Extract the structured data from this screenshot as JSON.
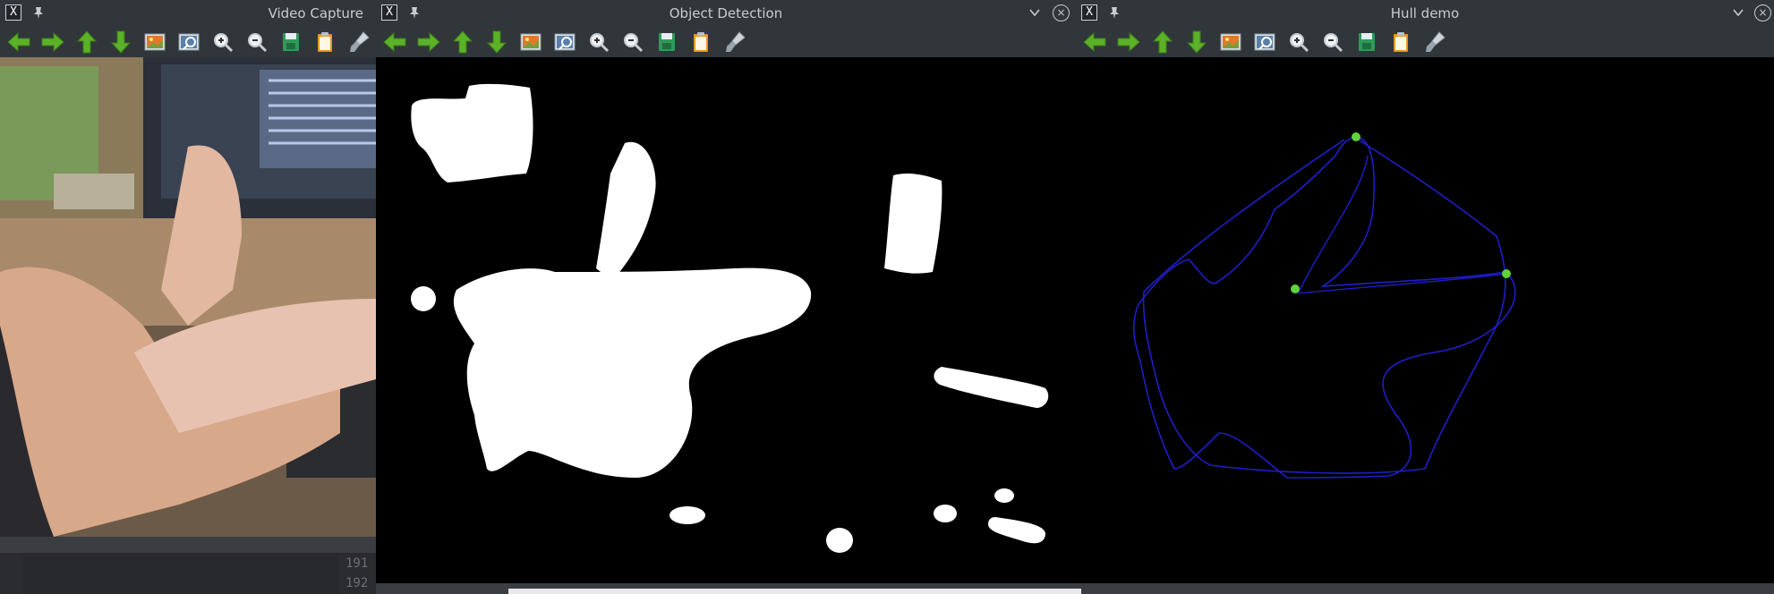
{
  "windows": {
    "video": {
      "title": "Video Capture"
    },
    "detect": {
      "title": "Object Detection"
    },
    "hull": {
      "title": "Hull demo"
    }
  },
  "app_icon_glyph": "X",
  "close_glyph": "×",
  "toolbar_icons": [
    "arrow-left-icon",
    "arrow-right-icon",
    "arrow-up-icon",
    "arrow-down-icon",
    "image-icon",
    "zoom-fit-icon",
    "zoom-in-icon",
    "zoom-out-icon",
    "save-icon",
    "clipboard-icon",
    "brush-icon"
  ],
  "editor_gutter": {
    "line_191": "191",
    "line_192": "192"
  },
  "colors": {
    "titlebar": "#31363b",
    "arrow": "#5bb128",
    "hull_line": "#1e1ec8",
    "hull_point": "#5fd23a"
  }
}
